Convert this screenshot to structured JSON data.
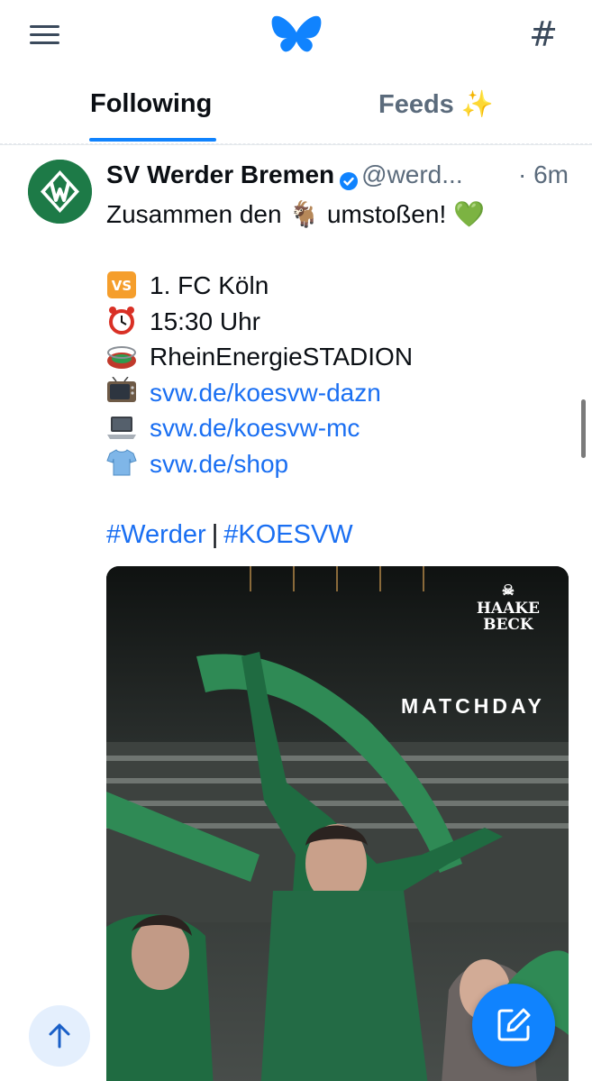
{
  "header": {
    "menu_icon": "hamburger-menu-icon",
    "logo_icon": "butterfly-logo-icon",
    "hash_icon": "hashtag-icon",
    "hash_glyph": "#"
  },
  "tabs": [
    {
      "label": "Following",
      "active": true
    },
    {
      "label": "Feeds ✨",
      "active": false
    }
  ],
  "post": {
    "author": "SV Werder Bremen",
    "verified": true,
    "handle": "@werd...",
    "time": "· 6m",
    "text": "Zusammen den 🐐 umstoßen! 💚",
    "lines": [
      {
        "icon": "vs-icon",
        "text": "1. FC Köln",
        "is_link": false
      },
      {
        "icon": "alarm-clock-icon",
        "text": "15:30 Uhr",
        "is_link": false
      },
      {
        "icon": "stadium-icon",
        "text": "RheinEnergieSTADION",
        "is_link": false
      },
      {
        "icon": "television-icon",
        "text": "svw.de/koesvw-dazn",
        "is_link": true
      },
      {
        "icon": "laptop-icon",
        "text": "svw.de/koesvw-mc",
        "is_link": true
      },
      {
        "icon": "shirt-icon",
        "text": "svw.de/shop",
        "is_link": true
      }
    ],
    "hashtags": [
      "#Werder",
      "#KOESVW"
    ],
    "hashtag_separator": "|",
    "image": {
      "brand_line1": "HAAKE",
      "brand_line2": "BECK",
      "caption": "MATCHDAY"
    }
  },
  "colors": {
    "accent": "#1083fe",
    "link": "#1a6ff2",
    "muted": "#5b6b7c",
    "werder_green": "#1d7a47"
  },
  "floating": {
    "scroll_top_icon": "arrow-up-icon",
    "compose_icon": "compose-pencil-icon"
  }
}
